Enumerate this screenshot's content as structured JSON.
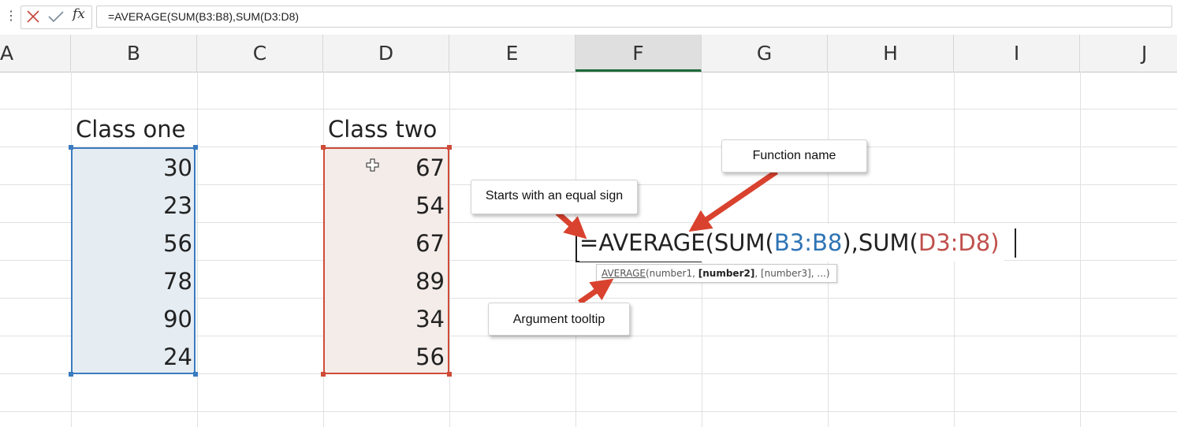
{
  "formula_bar": {
    "menu_glyph": "⋮",
    "fx_label": "fx",
    "formula": "=AVERAGE(SUM(B3:B8),SUM(D3:D8)"
  },
  "columns": {
    "A": "A",
    "B": "B",
    "C": "C",
    "D": "D",
    "E": "E",
    "F": "F",
    "G": "G",
    "H": "H",
    "I": "I",
    "J": "J"
  },
  "selected_column": "F",
  "class_one": {
    "header": "Class one",
    "values": [
      "30",
      "23",
      "56",
      "78",
      "90",
      "24"
    ]
  },
  "class_two": {
    "header": "Class two",
    "values": [
      "67",
      "54",
      "67",
      "89",
      "34",
      "56"
    ]
  },
  "edit_cell": {
    "eq": "=",
    "fn": "AVERAGE",
    "open1": "(",
    "sum1": "SUM(",
    "ref1": "B3:B8",
    "close_sep": "),",
    "sum2": "SUM(",
    "ref2": "D3:D8",
    "close2": ")"
  },
  "arg_tooltip": {
    "fn": "AVERAGE",
    "open": "(",
    "arg1": "number1, ",
    "arg2": "[number2]",
    "rest": ", [number3], ...)"
  },
  "callouts": {
    "function_name": "Function name",
    "equal_sign": "Starts with an equal sign",
    "argument_tooltip": "Argument tooltip"
  },
  "colors": {
    "ref_blue": "#2e74b5",
    "ref_red": "#c0504d",
    "arrow": "#d9422e",
    "selected_header_accent": "#1f6a3a"
  }
}
